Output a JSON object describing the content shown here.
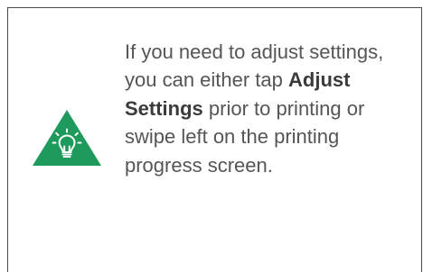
{
  "tip": {
    "icon": "lightbulb-icon",
    "icon_color": "#1e9a5c",
    "text_before": "If you need to adjust settings, you can either tap ",
    "emphasis": "Adjust Settings",
    "text_after": " prior to printing or swipe left on the printing progress screen."
  }
}
